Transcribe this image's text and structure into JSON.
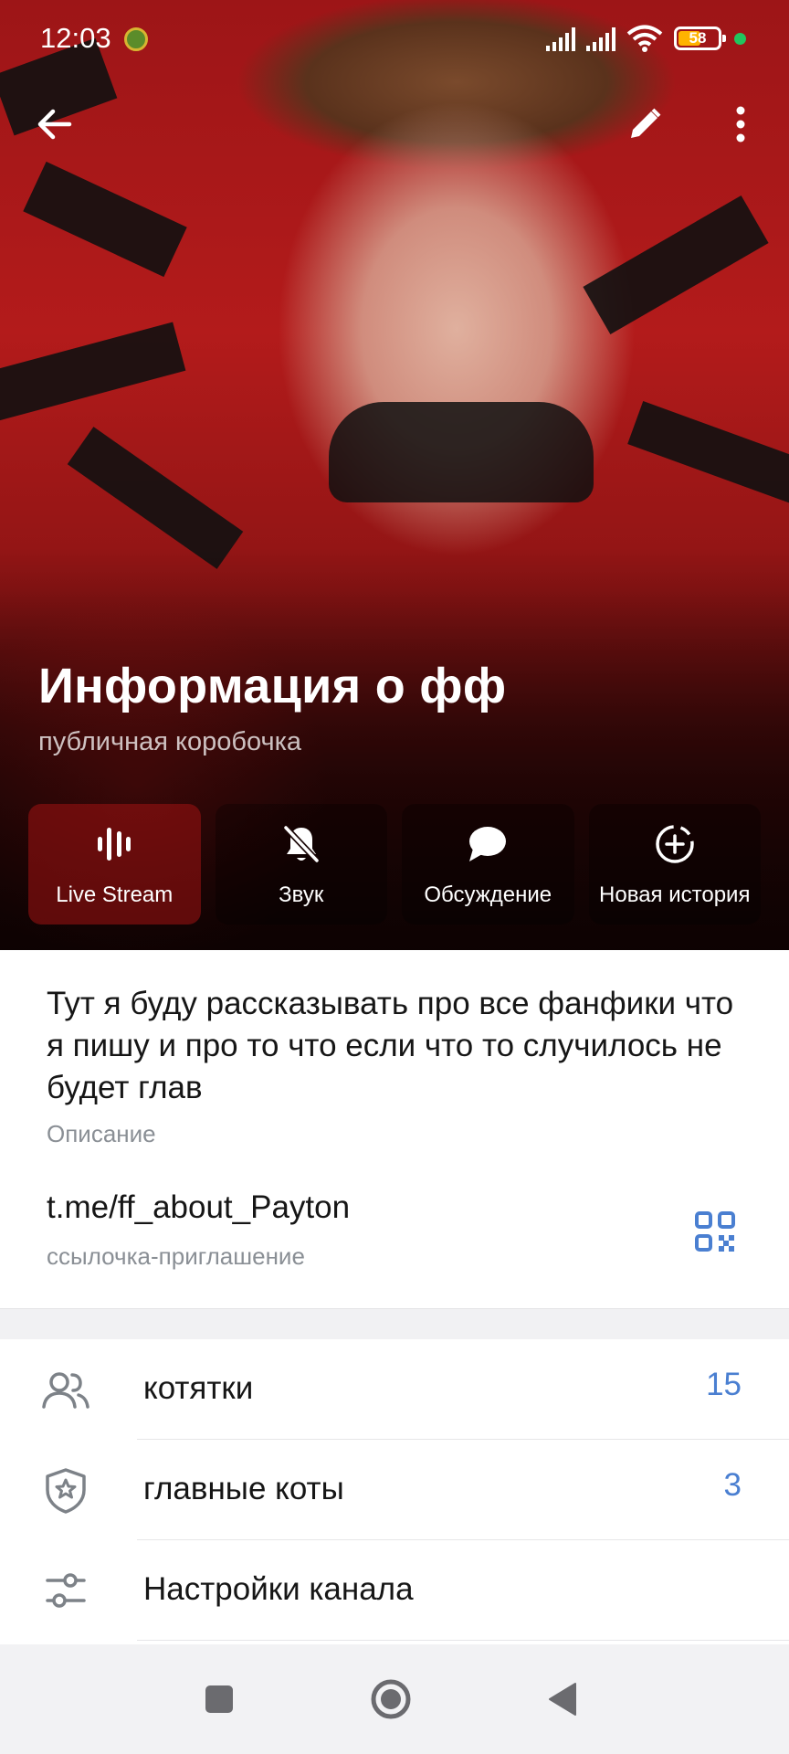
{
  "status_bar": {
    "time": "12:03",
    "battery": "58",
    "battery_level_percent": 58,
    "signal_icons": [
      "cell-signal-icon",
      "cell-signal-icon",
      "wifi-icon"
    ]
  },
  "toolbar": {
    "back_icon": "arrow-left-icon",
    "edit_icon": "pencil-icon",
    "more_icon": "more-vertical-icon"
  },
  "channel": {
    "title": "Информация о фф",
    "subtitle": "публичная коробочка"
  },
  "actions": [
    {
      "label": "Live Stream",
      "icon": "live-stream-icon"
    },
    {
      "label": "Звук",
      "icon": "bell-off-icon"
    },
    {
      "label": "Обсуждение",
      "icon": "chat-bubble-icon"
    },
    {
      "label": "Новая история",
      "icon": "add-story-icon"
    }
  ],
  "info": {
    "description": "Тут я буду рассказывать про все фанфики что я пишу и про то что если что то случилось не будет глав",
    "description_label": "Описание",
    "link": "t.me/ff_about_Payton",
    "link_label": "ссылочка-приглашение"
  },
  "menu": [
    {
      "label": "котятки",
      "count": "15",
      "icon": "users-icon"
    },
    {
      "label": "главные коты",
      "count": "3",
      "icon": "shield-star-icon"
    },
    {
      "label": "Настройки канала",
      "count": "",
      "icon": "sliders-icon"
    }
  ],
  "colors": {
    "accent": "#4a7fd1",
    "hero_red": "#b31b1b",
    "battery": "#ffb300",
    "status_dot": "#22c55e"
  }
}
